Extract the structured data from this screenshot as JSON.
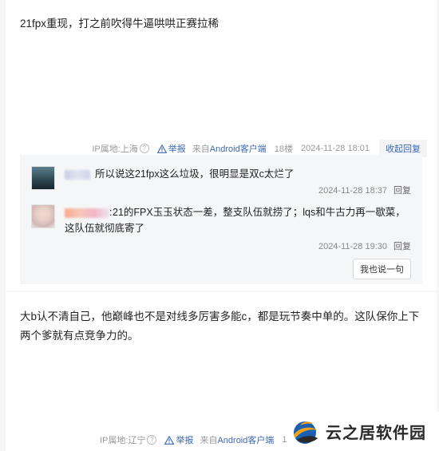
{
  "post1": {
    "text": "21fpx重现，打之前吹得牛逼哄哄正赛拉稀",
    "meta": {
      "ip": "IP属地:上海",
      "help": "?",
      "report": "举报",
      "source_prefix": "来自",
      "source_app": "Android客户端",
      "floor": "18楼",
      "time": "2024-11-28 18:01",
      "toggle": "收起回复"
    },
    "replies": [
      {
        "text": "所以说这21fpx这么垃圾，很明显是双c太烂了",
        "time": "2024-11-28 18:37",
        "reply": "回复"
      },
      {
        "prefix": ":",
        "text": " 21的FPX玉玉状态一差，整支队伍就捞了；lqs和牛古力再一歇菜，这队伍就彻底寄了",
        "time": "2024-11-28 19:30",
        "reply": "回复"
      }
    ],
    "say_button": "我也说一句"
  },
  "post2": {
    "text": "大b认不清自己，他巅峰也不是对线多厉害多能c，都是玩节奏中单的。这队保你上下两个爹就有点竞争力的。",
    "meta": {
      "ip": "IP属地:辽宁",
      "help": "?",
      "report": "举报",
      "source_prefix": "来自",
      "source_app": "Android客户端",
      "floor": "1"
    }
  },
  "watermark": {
    "text": "云之居软件园"
  },
  "colors": {
    "link": "#3a67b5",
    "muted": "#999999",
    "reply_bg": "#f5f6f8"
  },
  "icons": [
    "help-circle-icon",
    "warning-triangle-icon",
    "site-logo-icon"
  ]
}
